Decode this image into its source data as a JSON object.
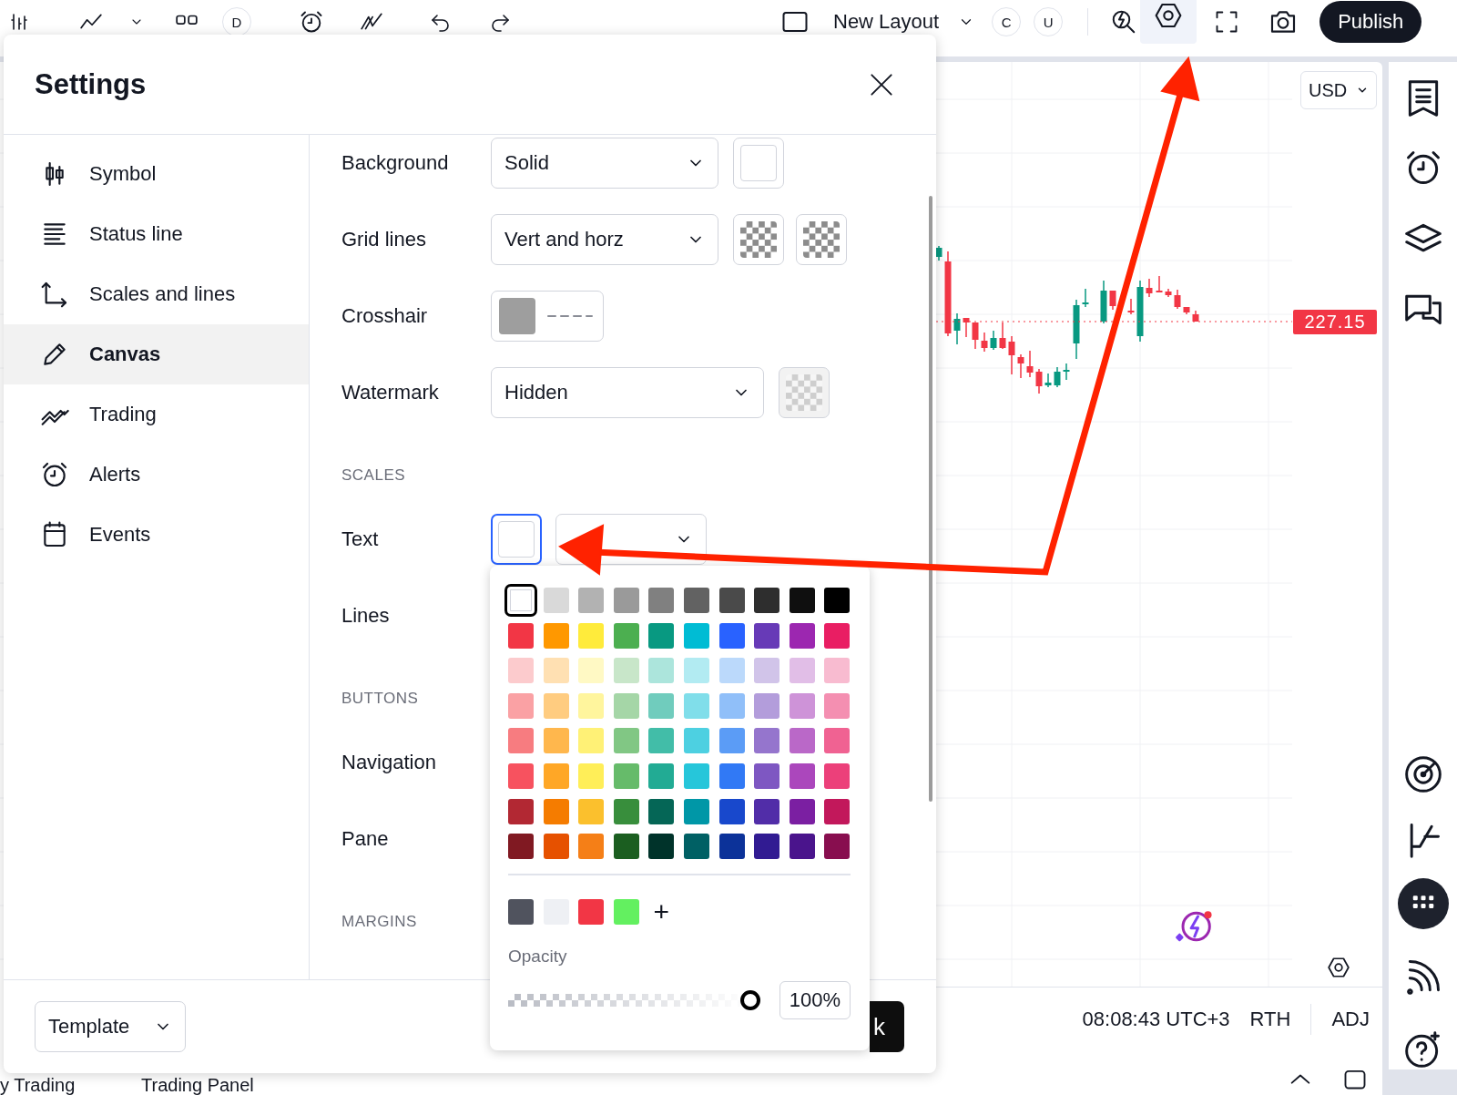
{
  "toolbar": {
    "interval": "D",
    "layout_name": "New Layout",
    "badges": [
      "C",
      "U"
    ],
    "settings_active": true,
    "publish": "Publish"
  },
  "dialog": {
    "title": "Settings",
    "nav": [
      {
        "label": "Symbol",
        "selected": false
      },
      {
        "label": "Status line",
        "selected": false
      },
      {
        "label": "Scales and lines",
        "selected": false
      },
      {
        "label": "Canvas",
        "selected": true
      },
      {
        "label": "Trading",
        "selected": false
      },
      {
        "label": "Alerts",
        "selected": false
      },
      {
        "label": "Events",
        "selected": false
      }
    ],
    "rows": [
      {
        "kind": "select",
        "label": "Background",
        "value": "Solid",
        "swatches": [
          {
            "kind": "solid",
            "color": "#ffffff",
            "disabled": false
          }
        ]
      },
      {
        "kind": "select",
        "label": "Grid lines",
        "value": "Vert and horz",
        "swatches": [
          {
            "kind": "checker",
            "disabled": false
          },
          {
            "kind": "checker",
            "disabled": false
          }
        ]
      },
      {
        "kind": "line-style",
        "label": "Crosshair",
        "color": "#9e9e9e"
      },
      {
        "kind": "select",
        "label": "Watermark",
        "value": "Hidden",
        "swatches": [
          {
            "kind": "checker",
            "disabled": true
          }
        ]
      },
      {
        "kind": "section",
        "label": "SCALES"
      },
      {
        "kind": "color-select",
        "label": "Text",
        "focused": true
      },
      {
        "kind": "plain",
        "label": "Lines"
      },
      {
        "kind": "section",
        "label": "BUTTONS"
      },
      {
        "kind": "plain",
        "label": "Navigation"
      },
      {
        "kind": "plain",
        "label": "Pane"
      },
      {
        "kind": "section",
        "label": "MARGINS"
      }
    ],
    "template": "Template",
    "ok": "k"
  },
  "color_picker": {
    "palette": [
      {
        "swatches": [
          {
            "color": "#ffffff",
            "selected": true
          },
          {
            "color": "#d9d9d9",
            "selected": false
          },
          {
            "color": "#b2b2b2",
            "selected": false
          },
          {
            "color": "#9a9a9a",
            "selected": false
          },
          {
            "color": "#808080",
            "selected": false
          },
          {
            "color": "#626262",
            "selected": false
          },
          {
            "color": "#4a4a4a",
            "selected": false
          },
          {
            "color": "#2e2e2e",
            "selected": false
          },
          {
            "color": "#0f0f0f",
            "selected": false
          },
          {
            "color": "#000000",
            "selected": false
          }
        ]
      },
      {
        "swatches": [
          {
            "color": "#f23645",
            "selected": false
          },
          {
            "color": "#ff9800",
            "selected": false
          },
          {
            "color": "#ffeb3b",
            "selected": false
          },
          {
            "color": "#4caf50",
            "selected": false
          },
          {
            "color": "#089981",
            "selected": false
          },
          {
            "color": "#00bcd4",
            "selected": false
          },
          {
            "color": "#2962ff",
            "selected": false
          },
          {
            "color": "#673ab7",
            "selected": false
          },
          {
            "color": "#9c27b0",
            "selected": false
          },
          {
            "color": "#e91e63",
            "selected": false
          }
        ]
      },
      {
        "swatches": [
          {
            "color": "#fccbcd",
            "selected": false
          },
          {
            "color": "#ffe0b2",
            "selected": false
          },
          {
            "color": "#fff9c4",
            "selected": false
          },
          {
            "color": "#c8e6c9",
            "selected": false
          },
          {
            "color": "#ace5dc",
            "selected": false
          },
          {
            "color": "#b2ebf2",
            "selected": false
          },
          {
            "color": "#bbd9fb",
            "selected": false
          },
          {
            "color": "#d1c4e9",
            "selected": false
          },
          {
            "color": "#e1bee7",
            "selected": false
          },
          {
            "color": "#f8bbd0",
            "selected": false
          }
        ]
      },
      {
        "swatches": [
          {
            "color": "#faa1a4",
            "selected": false
          },
          {
            "color": "#ffcc80",
            "selected": false
          },
          {
            "color": "#fff59d",
            "selected": false
          },
          {
            "color": "#a5d6a7",
            "selected": false
          },
          {
            "color": "#70ccbd",
            "selected": false
          },
          {
            "color": "#80deea",
            "selected": false
          },
          {
            "color": "#90bff9",
            "selected": false
          },
          {
            "color": "#b39ddb",
            "selected": false
          },
          {
            "color": "#ce93d8",
            "selected": false
          },
          {
            "color": "#f48fb1",
            "selected": false
          }
        ]
      },
      {
        "swatches": [
          {
            "color": "#f77c80",
            "selected": false
          },
          {
            "color": "#ffb74d",
            "selected": false
          },
          {
            "color": "#fff176",
            "selected": false
          },
          {
            "color": "#81c784",
            "selected": false
          },
          {
            "color": "#42bda8",
            "selected": false
          },
          {
            "color": "#4dd0e1",
            "selected": false
          },
          {
            "color": "#5b9cf6",
            "selected": false
          },
          {
            "color": "#9575cd",
            "selected": false
          },
          {
            "color": "#ba68c8",
            "selected": false
          },
          {
            "color": "#f06292",
            "selected": false
          }
        ]
      },
      {
        "swatches": [
          {
            "color": "#f7525f",
            "selected": false
          },
          {
            "color": "#ffa726",
            "selected": false
          },
          {
            "color": "#ffee58",
            "selected": false
          },
          {
            "color": "#66bb6a",
            "selected": false
          },
          {
            "color": "#22ab94",
            "selected": false
          },
          {
            "color": "#26c6da",
            "selected": false
          },
          {
            "color": "#3179f5",
            "selected": false
          },
          {
            "color": "#7e57c2",
            "selected": false
          },
          {
            "color": "#ab47bc",
            "selected": false
          },
          {
            "color": "#ec407a",
            "selected": false
          }
        ]
      },
      {
        "swatches": [
          {
            "color": "#b22833",
            "selected": false
          },
          {
            "color": "#f57c00",
            "selected": false
          },
          {
            "color": "#fbc02d",
            "selected": false
          },
          {
            "color": "#388e3c",
            "selected": false
          },
          {
            "color": "#056656",
            "selected": false
          },
          {
            "color": "#0097a7",
            "selected": false
          },
          {
            "color": "#1848cc",
            "selected": false
          },
          {
            "color": "#512da8",
            "selected": false
          },
          {
            "color": "#7b1fa2",
            "selected": false
          },
          {
            "color": "#c2185b",
            "selected": false
          }
        ]
      },
      {
        "swatches": [
          {
            "color": "#801922",
            "selected": false
          },
          {
            "color": "#e65100",
            "selected": false
          },
          {
            "color": "#f57f17",
            "selected": false
          },
          {
            "color": "#1b5e20",
            "selected": false
          },
          {
            "color": "#00332a",
            "selected": false
          },
          {
            "color": "#006064",
            "selected": false
          },
          {
            "color": "#0c3299",
            "selected": false
          },
          {
            "color": "#311b92",
            "selected": false
          },
          {
            "color": "#4a148c",
            "selected": false
          },
          {
            "color": "#880e4f",
            "selected": false
          }
        ]
      }
    ],
    "custom": [
      {
        "color": "#50535e"
      },
      {
        "color": "#eef0f4"
      },
      {
        "color": "#f23645"
      },
      {
        "color": "#63f060"
      }
    ],
    "add": "+",
    "opacity_label": "Opacity",
    "opacity": {
      "level": 1,
      "reading": "100%"
    }
  },
  "chart": {
    "currency": "USD",
    "last_price": "227.15",
    "time": "08:08:43 UTC+3",
    "session": "RTH",
    "adjustment": "ADJ"
  },
  "bottom_tabs": [
    "y Trading",
    "Trading Panel"
  ]
}
